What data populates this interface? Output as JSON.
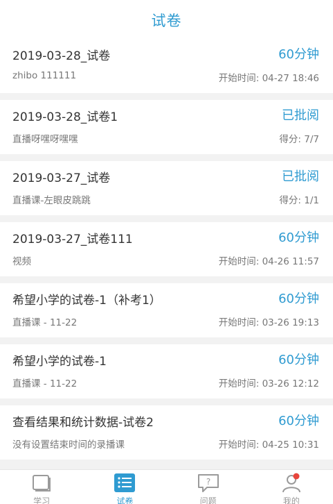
{
  "header": {
    "title": "试卷"
  },
  "papers": [
    {
      "name": "2019-03-28_试卷",
      "status": "60分钟",
      "subtitle": "zhibo 111111",
      "meta": "开始时间: 04-27 18:46"
    },
    {
      "name": "2019-03-28_试卷1",
      "status": "已批阅",
      "subtitle": "直播呀嘿呀嘿嘿",
      "meta": "得分: 7/7"
    },
    {
      "name": "2019-03-27_试卷",
      "status": "已批阅",
      "subtitle": "直播课-左眼皮跳跳",
      "meta": "得分: 1/1"
    },
    {
      "name": "2019-03-27_试卷111",
      "status": "60分钟",
      "subtitle": "视频",
      "meta": "开始时间: 04-26 11:57"
    },
    {
      "name": "希望小学的试卷-1（补考1）",
      "status": "60分钟",
      "subtitle": "直播课 - 11-22",
      "meta": "开始时间: 03-26 19:13"
    },
    {
      "name": "希望小学的试卷-1",
      "status": "60分钟",
      "subtitle": "直播课 - 11-22",
      "meta": "开始时间: 03-26 12:12"
    },
    {
      "name": "查看结果和统计数据-试卷2",
      "status": "60分钟",
      "subtitle": "没有设置结束时间的录播课",
      "meta": "开始时间: 04-25 10:31"
    }
  ],
  "tabs": [
    {
      "label": "学习",
      "icon": "book-icon"
    },
    {
      "label": "试卷",
      "icon": "paper-list-icon"
    },
    {
      "label": "问题",
      "icon": "question-chat-icon"
    },
    {
      "label": "我的",
      "icon": "user-icon"
    }
  ],
  "colors": {
    "accent": "#2f9bd1",
    "badge": "#e8453c"
  }
}
